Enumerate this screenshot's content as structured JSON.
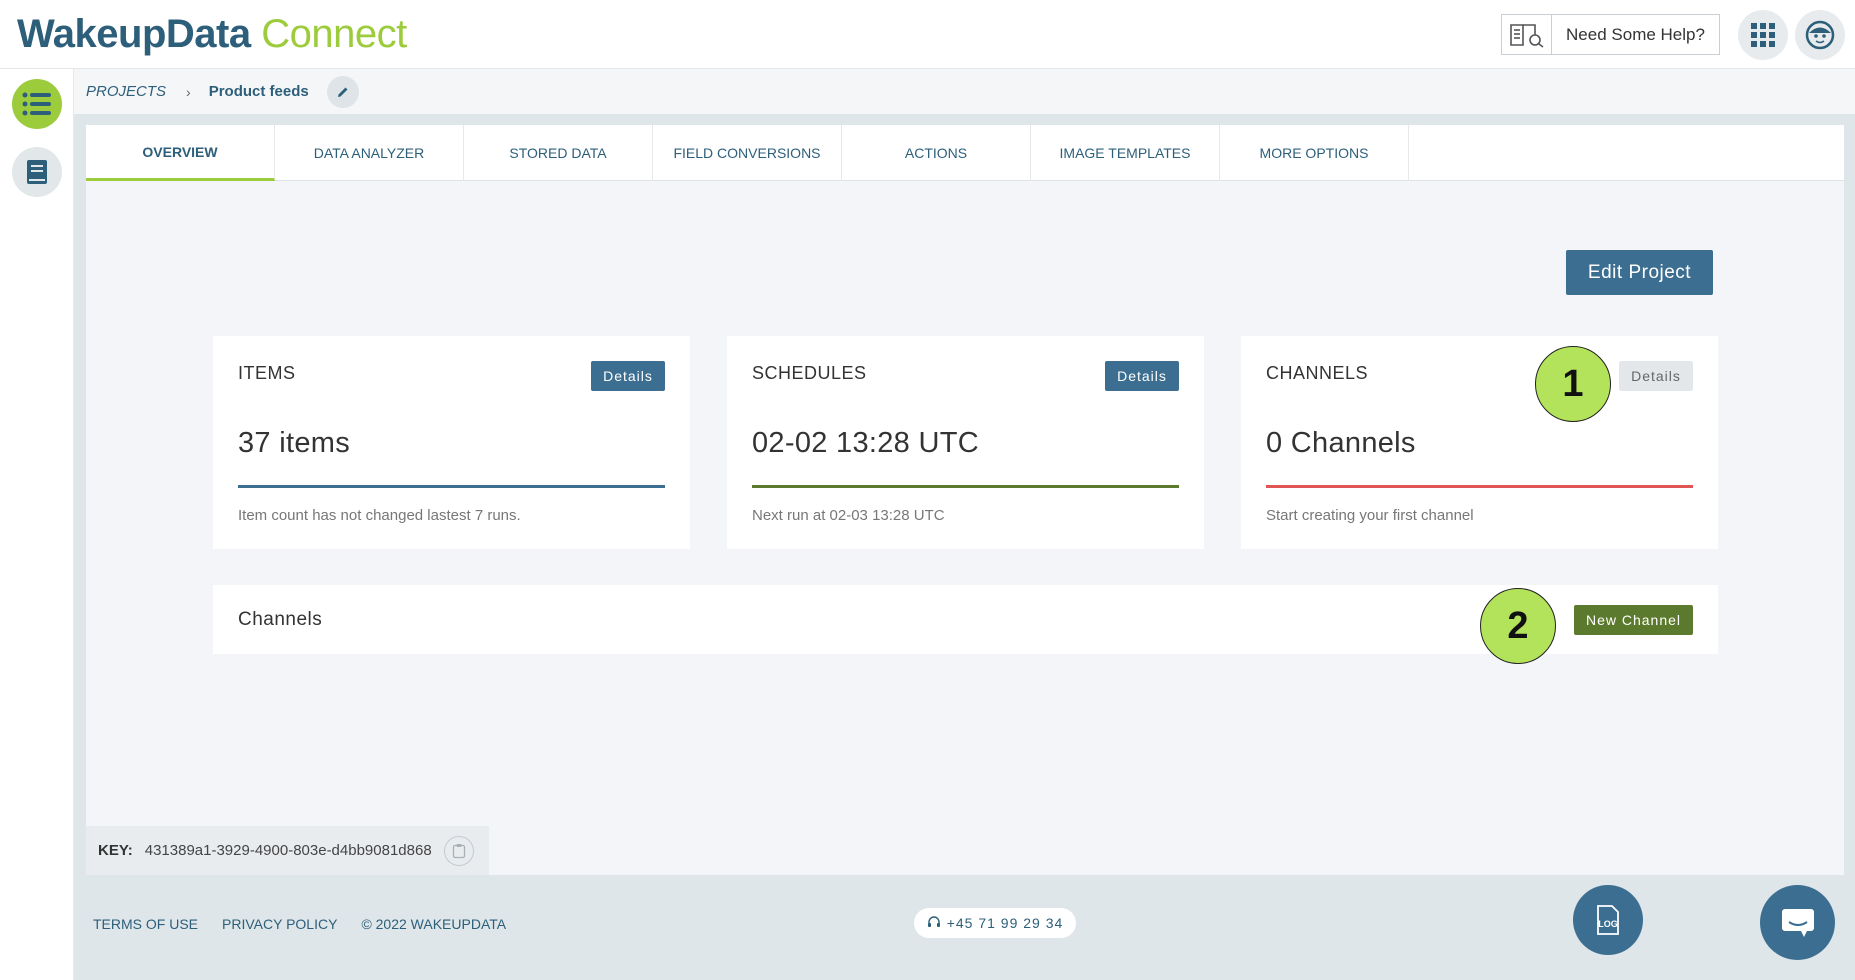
{
  "header": {
    "logo_part1": "WakeupData",
    "logo_part2": "Connect",
    "help_label": "Need Some Help?"
  },
  "breadcrumb": {
    "root": "PROJECTS",
    "separator": "›",
    "current": "Product feeds"
  },
  "tabs": [
    {
      "label": "OVERVIEW",
      "active": true
    },
    {
      "label": "DATA ANALYZER"
    },
    {
      "label": "STORED DATA"
    },
    {
      "label": "FIELD CONVERSIONS"
    },
    {
      "label": "ACTIONS"
    },
    {
      "label": "IMAGE TEMPLATES"
    },
    {
      "label": "MORE OPTIONS"
    }
  ],
  "edit_project_label": "Edit Project",
  "cards": {
    "items": {
      "title": "ITEMS",
      "button": "Details",
      "value": "37 items",
      "note": "Item count has not changed lastest 7 runs.",
      "line_color": "#3c6e91"
    },
    "schedules": {
      "title": "SCHEDULES",
      "button": "Details",
      "value": "02-02 13:28 UTC",
      "note": "Next run at 02-03 13:28 UTC",
      "line_color": "#5c7a2e"
    },
    "channels": {
      "title": "CHANNELS",
      "button": "Details",
      "value": "0 Channels",
      "note": "Start creating your first channel",
      "line_color": "#e05555"
    }
  },
  "channels_section": {
    "title": "Channels",
    "new_button": "New Channel"
  },
  "markers": {
    "one": "1",
    "two": "2"
  },
  "key": {
    "label": "KEY:",
    "value": "431389a1-3929-4900-803e-d4bb9081d868"
  },
  "footer": {
    "terms": "TERMS OF USE",
    "privacy": "PRIVACY POLICY",
    "copyright": "© 2022 WAKEUPDATA",
    "phone": "+45 71 99 29 34"
  },
  "colors": {
    "brand_blue": "#2d5f7a",
    "brand_green": "#9ccc3c",
    "button_blue": "#3c6e91",
    "button_green": "#5c7a2e",
    "marker_green": "#b3e35a"
  }
}
